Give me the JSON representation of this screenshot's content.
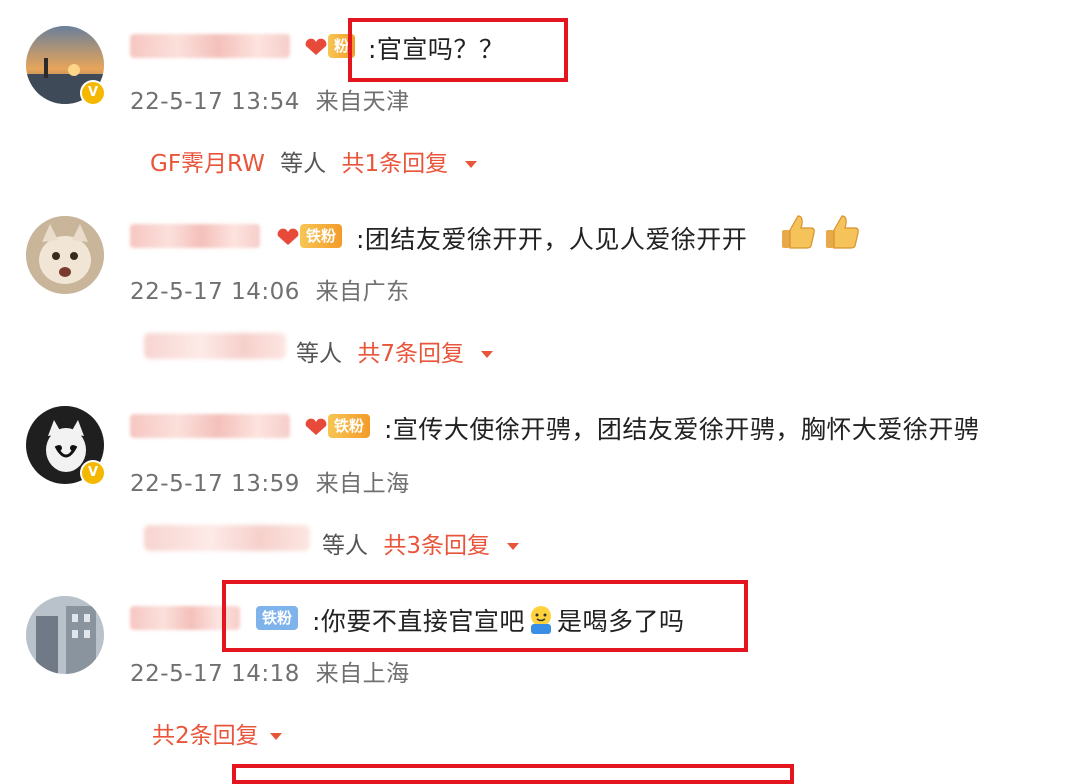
{
  "comments": [
    {
      "fan_label": "粉",
      "text": ":官宣吗？？",
      "time": "22-5-17 13:54",
      "source": "来自天津",
      "reply_users": "GF霁月RW",
      "reply_users_suffix": "等人",
      "reply_count": "共1条回复"
    },
    {
      "fan_label": "铁粉",
      "text": ":团结友爱徐开开，人见人爱徐开开",
      "time": "22-5-17 14:06",
      "source": "来自广东",
      "reply_users_suffix": "等人",
      "reply_count": "共7条回复"
    },
    {
      "fan_label": "铁粉",
      "text": ":宣传大使徐开骋，团结友爱徐开骋，胸怀大爱徐开骋",
      "time": "22-5-17 13:59",
      "source": "来自上海",
      "reply_users_suffix": "等人",
      "reply_count": "共3条回复"
    },
    {
      "fan_label": "铁粉",
      "text_before": ":你要不直接官宣吧",
      "text_after": "是喝多了吗",
      "time": "22-5-17 14:18",
      "source": "来自上海",
      "reply_count": "共2条回复"
    }
  ],
  "colors": {
    "highlight": "#e3161f",
    "reply_accent": "#e9553a",
    "verified_badge": "#f5b800"
  },
  "icons": [
    "verified-badge-icon",
    "thumbs-up-icon",
    "drinking-emoji-icon",
    "caret-down-icon"
  ]
}
